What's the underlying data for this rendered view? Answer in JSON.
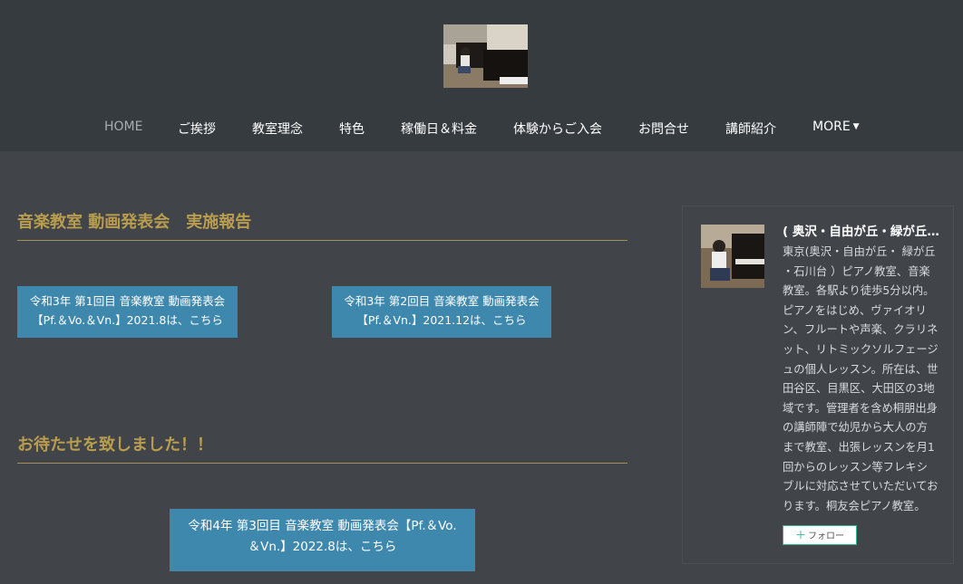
{
  "nav": {
    "items": [
      {
        "label": "HOME"
      },
      {
        "label": "ご挨拶"
      },
      {
        "label": "教室理念"
      },
      {
        "label": "特色"
      },
      {
        "label": "稼働日＆料金"
      },
      {
        "label": "体験からご入会"
      },
      {
        "label": "お問合せ"
      },
      {
        "label": "講師紹介"
      },
      {
        "label": "MORE"
      }
    ]
  },
  "main": {
    "section1": {
      "title": "音楽教室 動画発表会　実施報告",
      "buttons": [
        {
          "line1": "令和3年 第1回目 音楽教室 動画発表会",
          "line2": "【Pf.＆Vo.＆Vn.】2021.8は、こちら"
        },
        {
          "line1": "令和3年 第2回目 音楽教室 動画発表会",
          "line2": "【Pf.＆Vn.】2021.12は、こちら"
        }
      ]
    },
    "section2": {
      "title": "お待たせを致しました！！",
      "button": {
        "line1": "令和4年 第3回目 音楽教室 動画発表会【Pf.＆Vo.",
        "line2": "＆Vn.】2022.8は、こちら"
      }
    }
  },
  "sidebar": {
    "name": "( 奥沢・自由が丘・緑が丘・石川台 ) 桐友会ピアノ教室",
    "description": "東京(奥沢・自由が丘・ 緑が丘 ・石川台 ）ピアノ教室、音楽教室。各駅より徒歩5分以内。ピアノをはじめ、ヴァイオリン、フルートや声楽、クラリネット、リトミックソルフェージュの個人レッスン。所在は、世田谷区、目黒区、大田区の3地域です。管理者を含め桐朋出身の講師陣で幼児から大人の方まで教室、出張レッスンを月1回からのレッスン等フレキシブルに対応させていただいております。桐友会ピアノ教室。",
    "follow_label": "フォロー"
  }
}
